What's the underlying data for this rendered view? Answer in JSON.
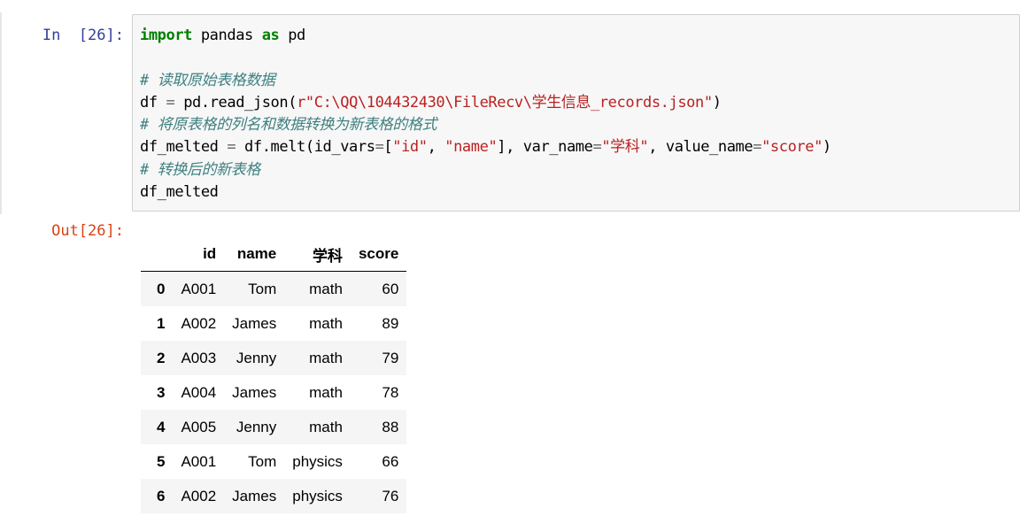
{
  "input_prompt": "In  [26]:",
  "output_prompt": "Out[26]:",
  "code": {
    "line1": {
      "kw_import": "import",
      "module": " pandas ",
      "kw_as": "as",
      "alias": " pd"
    },
    "line2": "",
    "line3": "# 读取原始表格数据",
    "line4": {
      "lhs": "df ",
      "eq": "=",
      "call": " pd.read_json(",
      "str": "r\"C:\\QQ\\104432430\\FileRecv\\学生信息_records.json\"",
      "close": ")"
    },
    "line5": "# 将原表格的列名和数据转换为新表格的格式",
    "line6": {
      "lhs": "df_melted ",
      "eq": "=",
      "call": " df.melt(id_vars",
      "eq2": "=",
      "lb": "[",
      "s1": "\"id\"",
      "comma1": ", ",
      "s2": "\"name\"",
      "rb": "], var_name",
      "eq3": "=",
      "s3": "\"学科\"",
      "comma2": ", value_name",
      "eq4": "=",
      "s4": "\"score\"",
      "close": ")"
    },
    "line7": "# 转换后的新表格",
    "line8": "df_melted"
  },
  "table": {
    "columns": [
      "",
      "id",
      "name",
      "学科",
      "score"
    ],
    "rows": [
      {
        "index": "0",
        "id": "A001",
        "name": "Tom",
        "subject": "math",
        "score": "60"
      },
      {
        "index": "1",
        "id": "A002",
        "name": "James",
        "subject": "math",
        "score": "89"
      },
      {
        "index": "2",
        "id": "A003",
        "name": "Jenny",
        "subject": "math",
        "score": "79"
      },
      {
        "index": "3",
        "id": "A004",
        "name": "James",
        "subject": "math",
        "score": "78"
      },
      {
        "index": "4",
        "id": "A005",
        "name": "Jenny",
        "subject": "math",
        "score": "88"
      },
      {
        "index": "5",
        "id": "A001",
        "name": "Tom",
        "subject": "physics",
        "score": "66"
      },
      {
        "index": "6",
        "id": "A002",
        "name": "James",
        "subject": "physics",
        "score": "76"
      }
    ]
  }
}
